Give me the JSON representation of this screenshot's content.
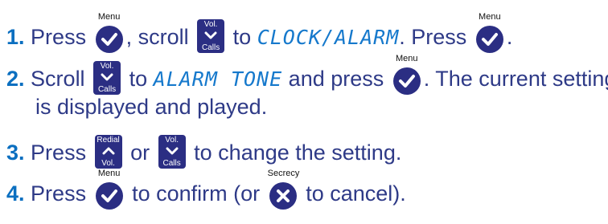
{
  "steps": [
    {
      "number": "1.",
      "parts": {
        "a": "Press",
        "b": ", scroll",
        "c": "to",
        "lcd": "CLOCK/ALARM",
        "d": ". Press",
        "e": "."
      }
    },
    {
      "number": "2.",
      "parts": {
        "a": "Scroll",
        "b": "to",
        "lcd": "ALARM TONE",
        "c": "and press",
        "d": ". The current setting",
        "line2": "is displayed and played."
      }
    },
    {
      "number": "3.",
      "parts": {
        "a": "Press",
        "b": "or",
        "c": "to change the setting."
      }
    },
    {
      "number": "4.",
      "parts": {
        "a": "Press",
        "b": "to confirm (or",
        "c": "to cancel)."
      }
    }
  ],
  "keys": {
    "menu": {
      "label": "Menu",
      "icon": "checkmark-icon"
    },
    "secrecy": {
      "label": "Secrecy",
      "icon": "cross-icon"
    },
    "vol_calls": {
      "top": "Vol.",
      "bottom": "Calls",
      "icon": "chevron-down-icon"
    },
    "redial_vol": {
      "top": "Redial",
      "bottom": "Vol.",
      "icon": "chevron-up-icon"
    }
  },
  "colors": {
    "text": "#2e3a87",
    "step_number": "#0b6fc0",
    "lcd_text": "#1679cc",
    "key_fill": "#2b2e83"
  }
}
